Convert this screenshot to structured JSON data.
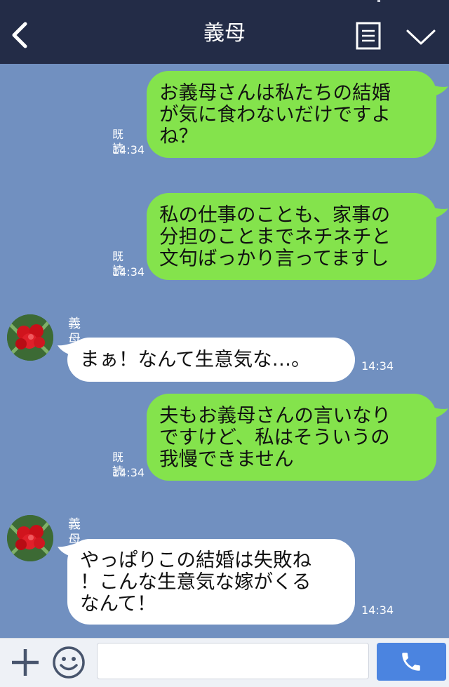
{
  "header": {
    "title": "義母"
  },
  "messages": [
    {
      "side": "me",
      "text": "お義母さんは私たちの結婚\nが気に食わないだけですよ\nね？",
      "read": "既読",
      "time": "14:34"
    },
    {
      "side": "me",
      "text": "私の仕事のことも、家事の\n分担のことまでネチネチと\n文句ばっかり言ってますし",
      "read": "既読",
      "time": "14:34"
    },
    {
      "side": "them",
      "sender": "義母",
      "text": "まぁ！なんて生意気な…。",
      "time": "14:34"
    },
    {
      "side": "me",
      "text": "夫もお義母さんの言いなり\nですけど、私はそういうの\n我慢できません",
      "read": "既読",
      "time": "14:34"
    },
    {
      "side": "them",
      "sender": "義母",
      "text": "やっぱりこの結婚は失敗ね\n！こんな生意気な嫁がくる\nなんて！",
      "time": "14:34"
    }
  ],
  "input": {
    "value": ""
  },
  "colors": {
    "header_bg": "#232c47",
    "chat_bg": "#7190c0",
    "my_bubble": "#84e34c",
    "their_bubble": "#ffffff",
    "call_button": "#4b84e0"
  },
  "icons": {
    "back": "chevron-left-icon",
    "menu": "document-menu-icon",
    "collapse": "chevron-down-icon",
    "add": "plus-icon",
    "emoji": "smile-icon",
    "call": "phone-icon"
  }
}
